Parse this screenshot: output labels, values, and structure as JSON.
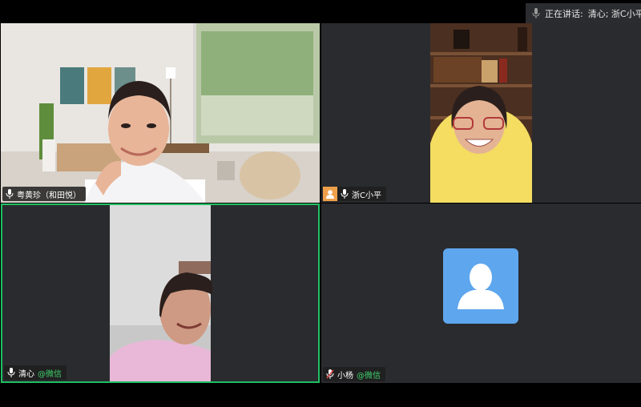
{
  "speaking": {
    "prefix": "正在讲话:",
    "names": "清心; 浙C小平"
  },
  "participants": [
    {
      "name": "粤黄珍（和田悦）",
      "suffix": ""
    },
    {
      "name": "浙C小平",
      "suffix": ""
    },
    {
      "name": "清心",
      "suffix": "@微信"
    },
    {
      "name": "小杨",
      "suffix": "@微信"
    }
  ],
  "colors": {
    "active_border": "#1fbf63",
    "avatar_bg": "#5ea6ee",
    "wechat_suffix": "#3ed06a"
  },
  "icons": {
    "mic": "mic-icon",
    "muted_mic": "mic-muted-icon",
    "user": "user-icon"
  }
}
